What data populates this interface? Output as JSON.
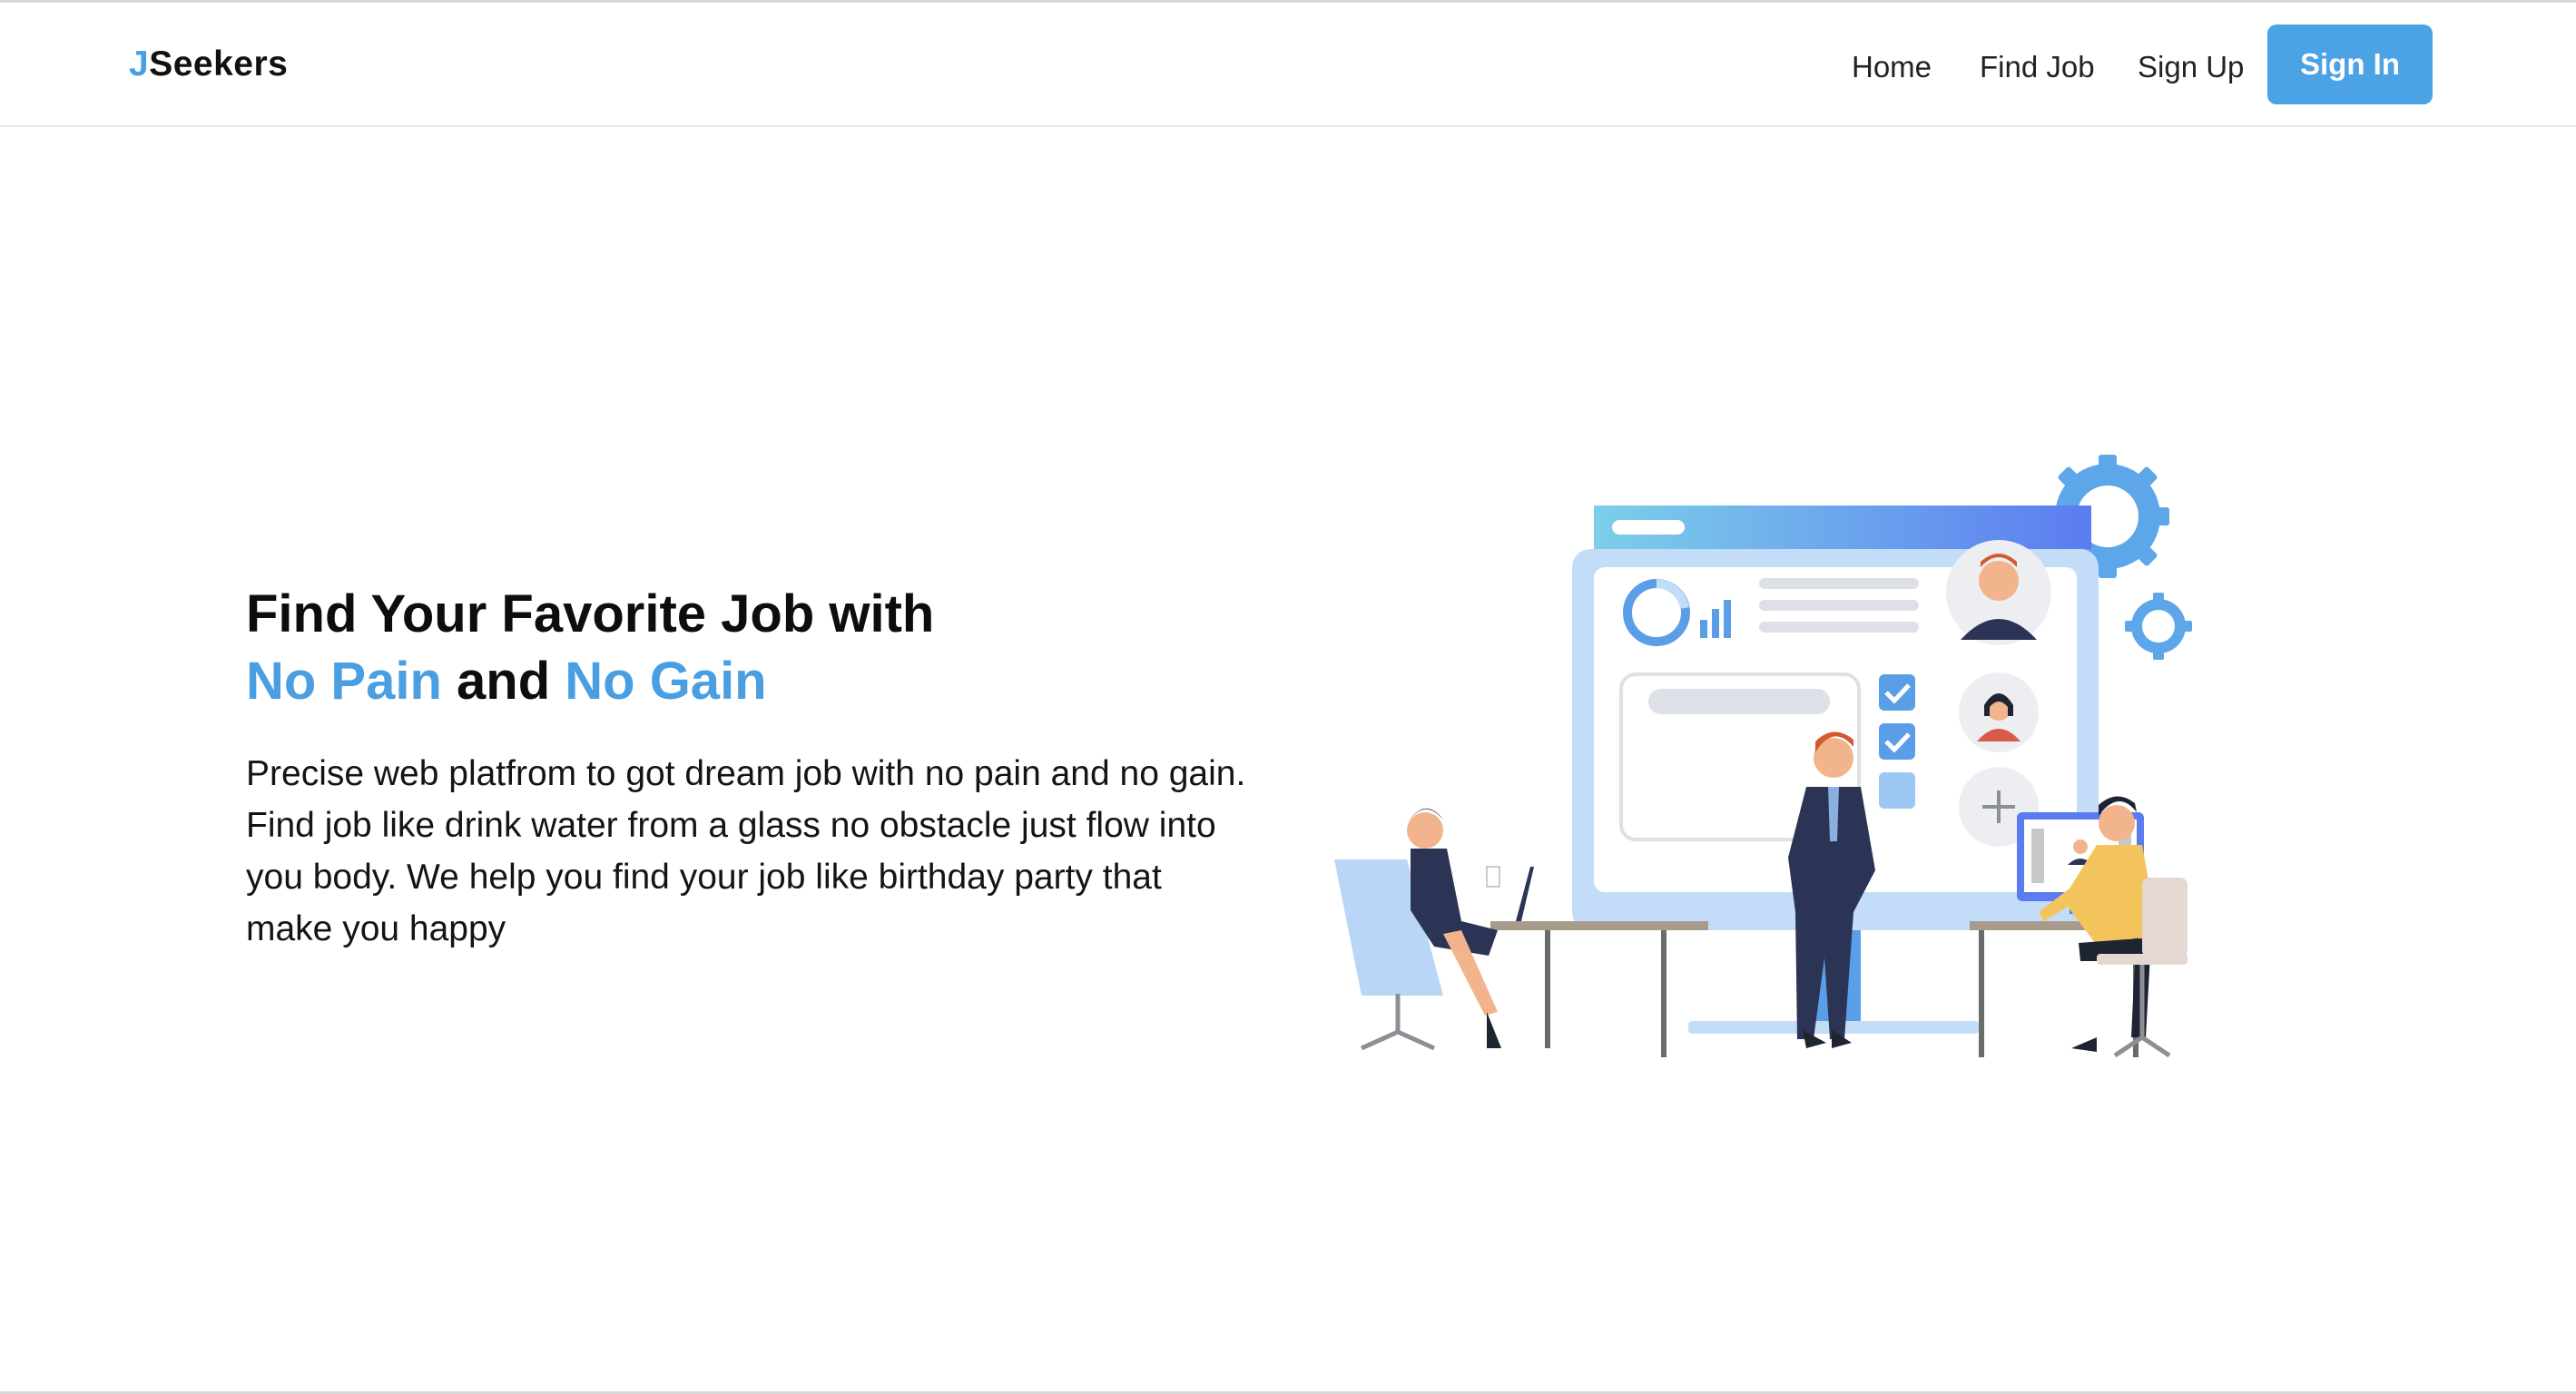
{
  "brand": {
    "logo_initial": "J",
    "logo_rest": "Seekers"
  },
  "nav": {
    "home": "Home",
    "find_job": "Find Job",
    "sign_up": "Sign Up",
    "sign_in": "Sign In"
  },
  "hero": {
    "title_line1": "Find Your Favorite Job with",
    "title_blue1": "No Pain",
    "title_and": " and ",
    "title_blue2": "No Gain",
    "description": "Precise web platfrom to got dream job with no pain and no gain. Find job like drink water from a glass no obstacle just flow into you body. We help you find your job like birthday party that make you happy"
  },
  "colors": {
    "accent": "#4a9ee2",
    "button": "#4ba2e4",
    "text": "#111111"
  },
  "illustration": {
    "icon": "job-seekers-office-illustration"
  }
}
